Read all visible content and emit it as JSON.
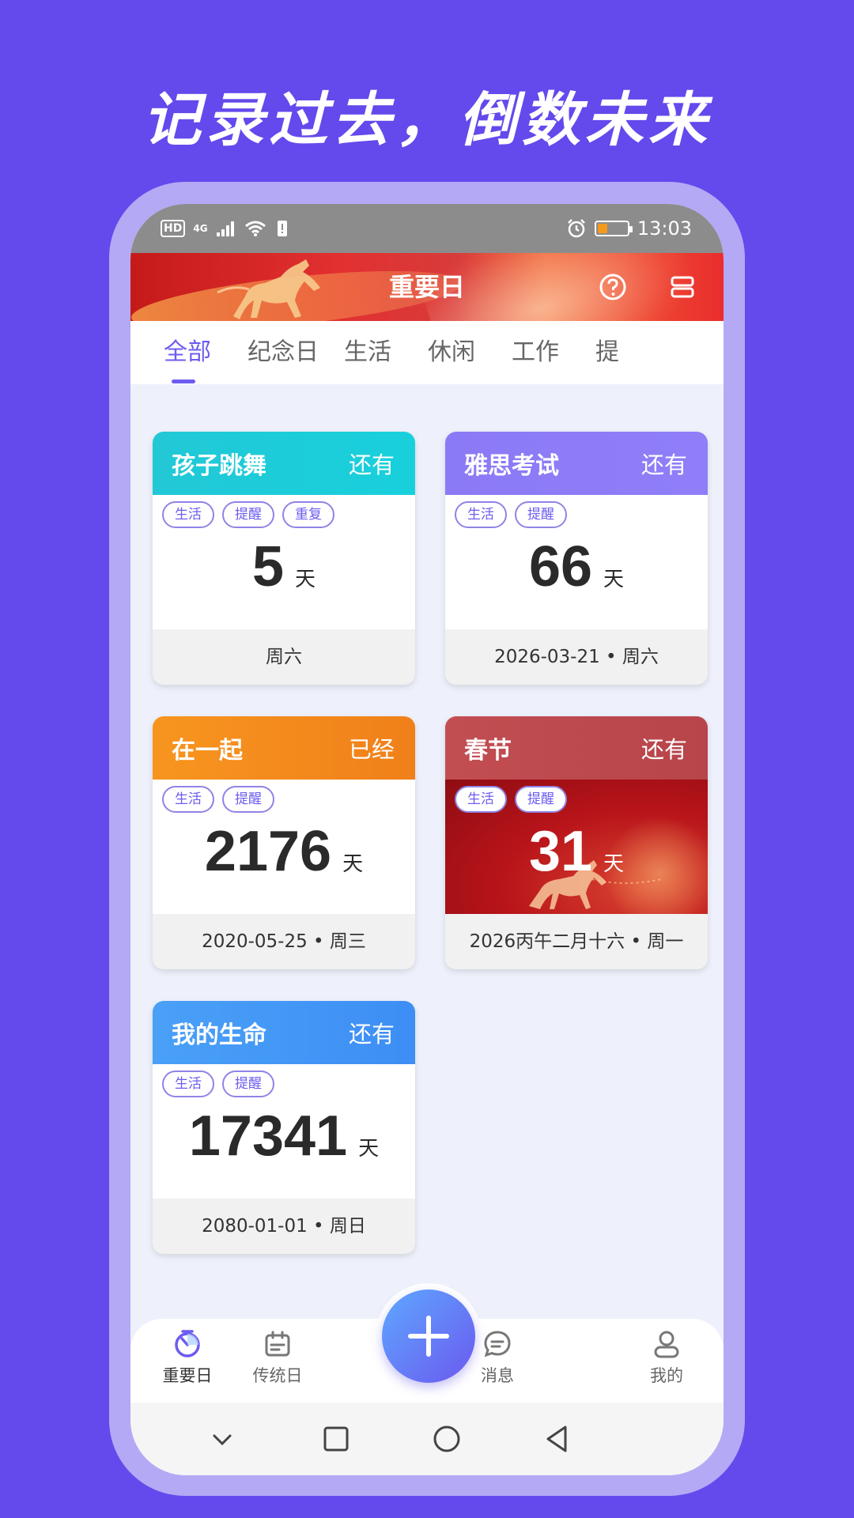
{
  "headline": "记录过去，倒数未来",
  "status_bar": {
    "left_badge": "HD",
    "network": "4G",
    "time": "13:03"
  },
  "header": {
    "title": "重要日",
    "help_icon": "question-icon",
    "layout_icon": "list-layout-icon"
  },
  "tabs": [
    {
      "label": "全部",
      "active": true
    },
    {
      "label": "纪念日",
      "active": false
    },
    {
      "label": "生活",
      "active": false
    },
    {
      "label": "休闲",
      "active": false
    },
    {
      "label": "工作",
      "active": false
    },
    {
      "label": "提",
      "active": false
    }
  ],
  "cards": [
    {
      "title": "孩子跳舞",
      "status": "还有",
      "tags": [
        "生活",
        "提醒",
        "重复"
      ],
      "count": "5",
      "unit": "天",
      "footer": "周六",
      "color": "#1fc9d8"
    },
    {
      "title": "雅思考试",
      "status": "还有",
      "tags": [
        "生活",
        "提醒"
      ],
      "count": "66",
      "unit": "天",
      "footer": "2026-03-21 • 周六",
      "color": "#8a78f5"
    },
    {
      "title": "在一起",
      "status": "已经",
      "tags": [
        "生活",
        "提醒"
      ],
      "count": "2176",
      "unit": "天",
      "footer": "2020-05-25 • 周三",
      "color": "#f58a1f"
    },
    {
      "title": "春节",
      "status": "还有",
      "tags": [
        "生活",
        "提醒"
      ],
      "count": "31",
      "unit": "天",
      "footer": "2026丙午二月十六 • 周一",
      "color": "#c0454a"
    },
    {
      "title": "我的生命",
      "status": "还有",
      "tags": [
        "生活",
        "提醒"
      ],
      "count": "17341",
      "unit": "天",
      "footer": "2080-01-01  • 周日",
      "color": "#4b9cf6"
    }
  ],
  "bottom_nav": [
    {
      "label": "重要日",
      "icon": "timer-icon",
      "active": true
    },
    {
      "label": "传统日",
      "icon": "calendar-icon",
      "active": false
    },
    {
      "label": "消息",
      "icon": "message-icon",
      "active": false
    },
    {
      "label": "我的",
      "icon": "user-icon",
      "active": false
    }
  ],
  "fab_icon": "plus-icon",
  "colors": {
    "background": "#6449ec",
    "accent": "#6c5cf0",
    "frame": "#b3a9f5"
  }
}
